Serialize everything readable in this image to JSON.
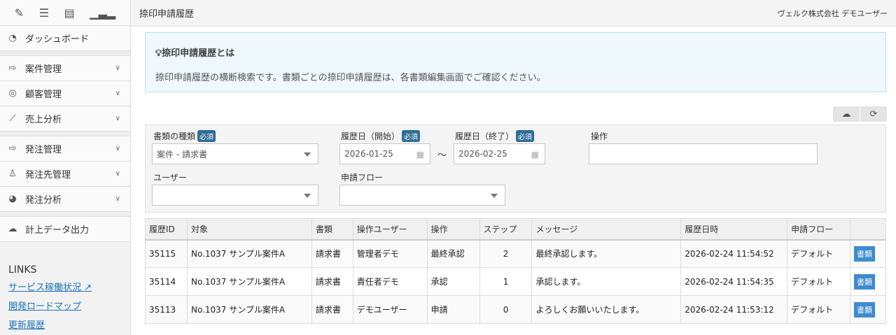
{
  "header": {
    "title": "捺印申請履歴",
    "user": "ヴェルク株式会社 デモユーザー"
  },
  "sidebar": {
    "items": [
      {
        "label": "ダッシュボード"
      },
      {
        "label": "案件管理"
      },
      {
        "label": "顧客管理"
      },
      {
        "label": "売上分析"
      },
      {
        "label": "発注管理"
      },
      {
        "label": "発注先管理"
      },
      {
        "label": "発注分析"
      },
      {
        "label": "計上データ出力"
      }
    ],
    "links_title": "LINKS",
    "links": [
      "サービス稼働状況",
      "開発ロードマップ",
      "更新履歴"
    ]
  },
  "info": {
    "title": "捺印申請履歴とは",
    "text": "捺印申請履歴の横断検索です。書類ごとの捺印申請履歴は、各書類編集画面でご確認ください。"
  },
  "filter": {
    "required": "必須",
    "doc_type_label": "書類の種類",
    "doc_type_value": "案件 - 請求書",
    "start_label": "履歴日（開始）",
    "start_value": "2026-01-25",
    "tilde": "〜",
    "end_label": "履歴日（終了）",
    "end_value": "2026-02-25",
    "op_label": "操作",
    "user_label": "ユーザー",
    "flow_label": "申請フロー"
  },
  "table": {
    "headers": [
      "履歴ID",
      "対象",
      "書類",
      "操作ユーザー",
      "操作",
      "ステップ",
      "メッセージ",
      "履歴日時",
      "申請フロー",
      ""
    ],
    "rows": [
      [
        "35115",
        "No.1037 サンプル案件A",
        "請求書",
        "管理者デモ",
        "最終承認",
        "2",
        "最終承認します。",
        "2026-02-24 11:54:52",
        "デフォルト",
        "書類"
      ],
      [
        "35114",
        "No.1037 サンプル案件A",
        "請求書",
        "責任者デモ",
        "承認",
        "1",
        "承認します。",
        "2026-02-24 11:54:35",
        "デフォルト",
        "書類"
      ],
      [
        "35113",
        "No.1037 サンプル案件A",
        "請求書",
        "デモユーザー",
        "申請",
        "0",
        "よろしくお願いいたします。",
        "2026-02-24 11:53:12",
        "デフォルト",
        "書類"
      ]
    ]
  }
}
